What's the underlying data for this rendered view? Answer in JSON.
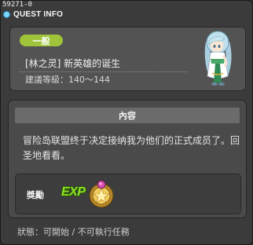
{
  "window": {
    "id_text": "59271-0",
    "title": "QUEST INFO"
  },
  "header": {
    "category_tag": "一般",
    "quest_name": "[林之灵] 新英雄的诞生",
    "level_label": "建議等級：",
    "level_range": "140～144"
  },
  "content": {
    "section_title": "內容",
    "description": "冒险岛联盟终于决定接纳我为他们的正式成员了。回圣地看看。"
  },
  "reward": {
    "label": "獎勵",
    "exp_text": "EXP"
  },
  "status": {
    "label": "狀態：",
    "value": "可開始 / 不可執行任務"
  }
}
